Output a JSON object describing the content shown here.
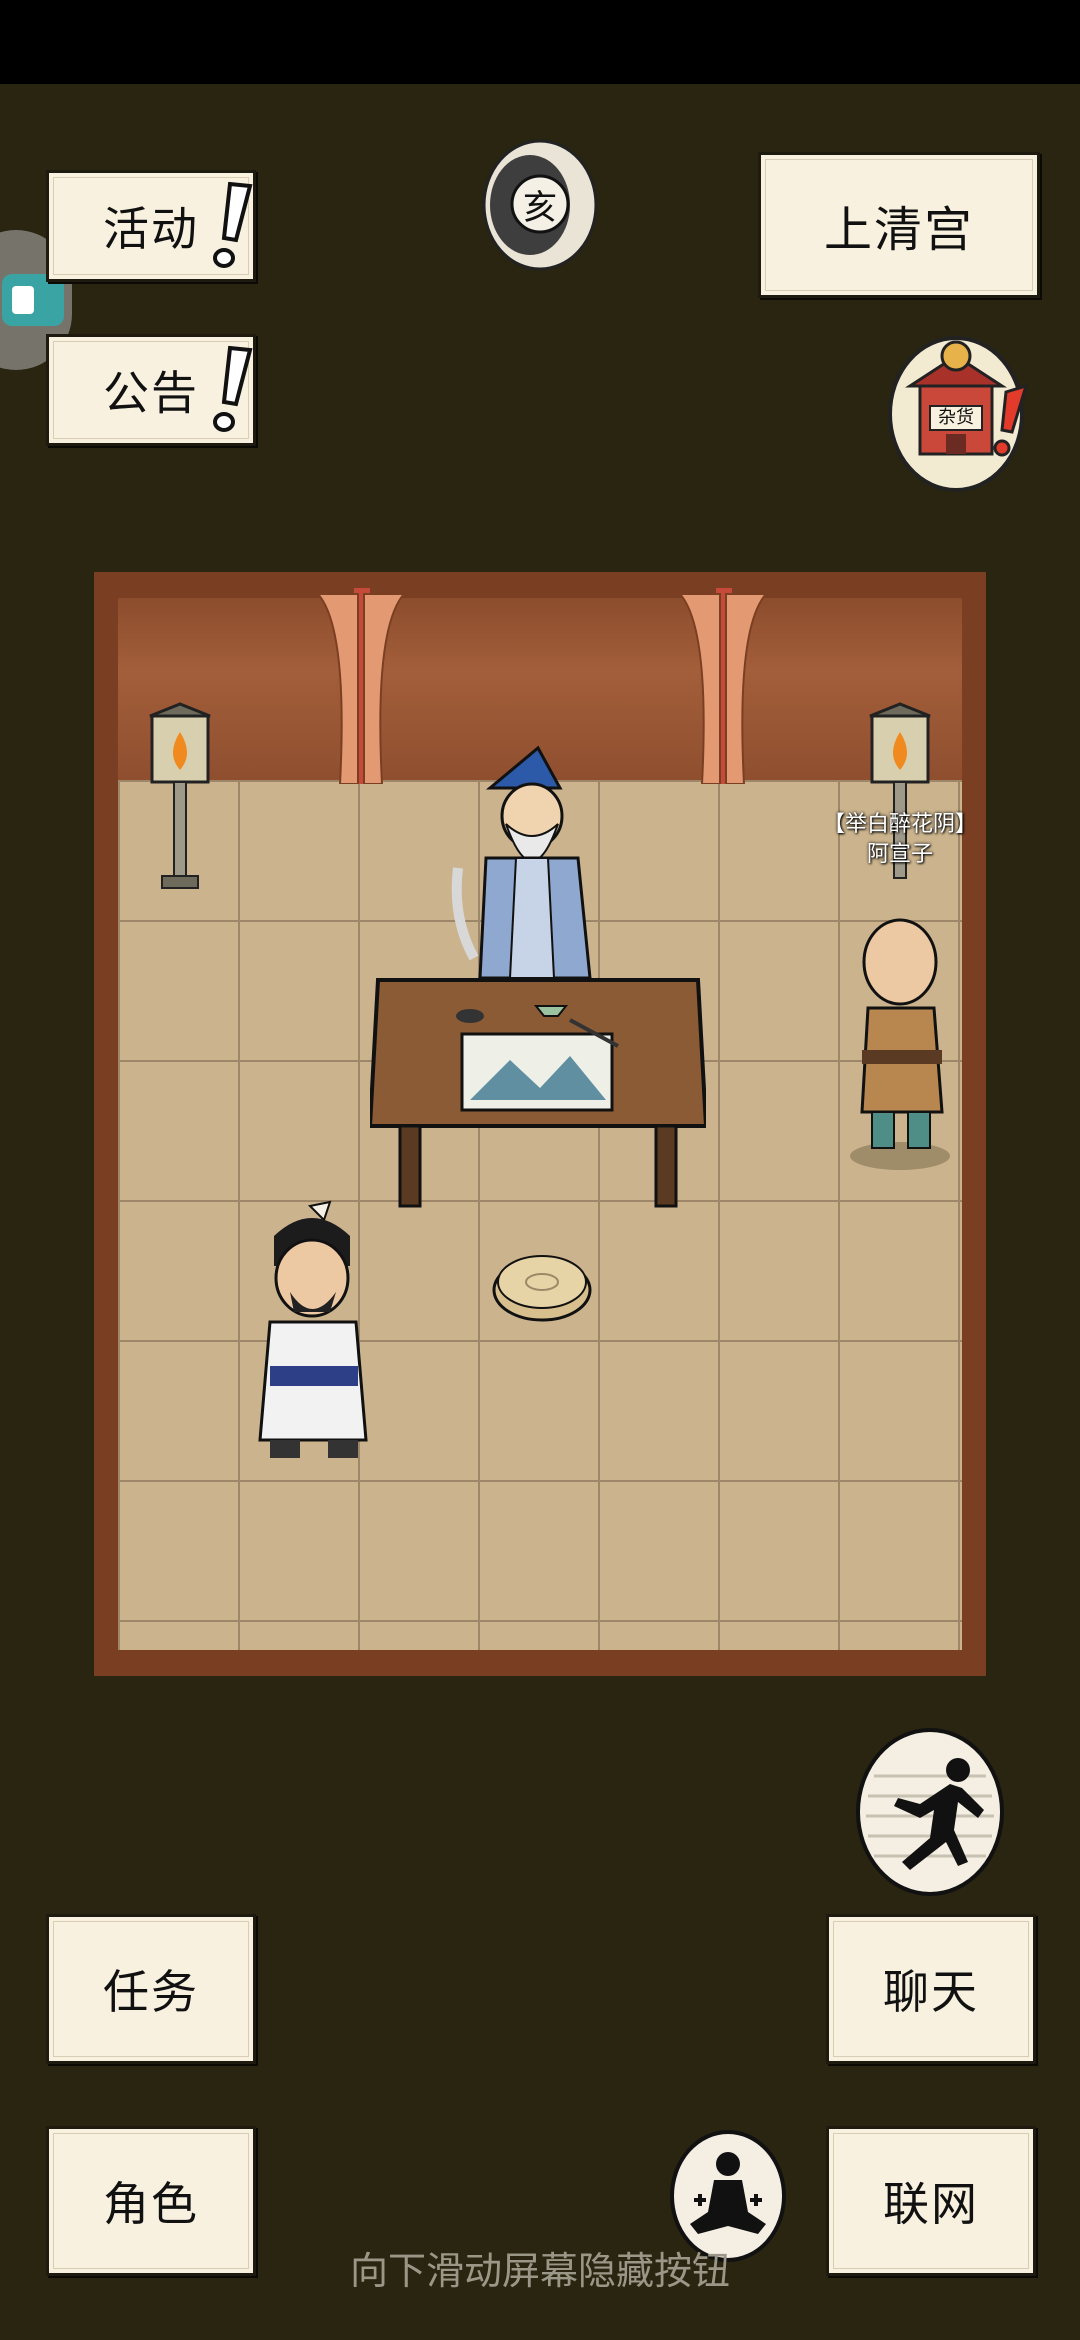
{
  "top_left": {
    "activity_label": "活动",
    "notice_label": "公告"
  },
  "time_badge": {
    "glyph": "亥"
  },
  "location": {
    "name": "上清宫"
  },
  "shop": {
    "sign": "杂货",
    "icon": "shop-icon"
  },
  "npc": {
    "title": "【举白醉花阴】",
    "name": "阿宣子"
  },
  "bottom_left": {
    "quest_label": "任务",
    "character_label": "角色"
  },
  "bottom_right": {
    "chat_label": "聊天",
    "network_label": "联网"
  },
  "icons": {
    "run": "run-icon",
    "meditate": "meditate-icon"
  },
  "hint_text": "向下滑动屏幕隐藏按钮",
  "colors": {
    "background": "#2a2510",
    "paper": "#f8f1e0",
    "alert_red": "#e23b2b",
    "room_frame": "#7a3f22"
  }
}
